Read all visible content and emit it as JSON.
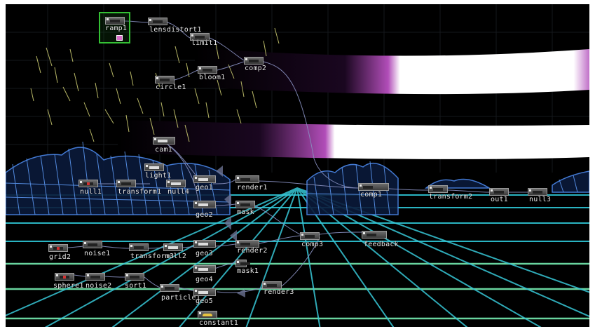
{
  "app": {
    "colors": {
      "canvas_background": "#000000",
      "grid_cyan": "#3fd7e0",
      "grid_green": "#7fe8a0",
      "terrain_blue": "#4a86e8",
      "band_magenta": "#c04fc0",
      "band_white": "#ffffff",
      "spark_yellow": "#d8d878",
      "node_selection_green": "#34c034",
      "wire_color": "#8890c0"
    }
  },
  "network": {
    "nodes": [
      {
        "id": "ramp1",
        "label": "ramp1",
        "icon": "ramp-op-icon",
        "selected": true
      },
      {
        "id": "lensdistort1",
        "label": "lensdistort1",
        "icon": "lensdistort-op-icon"
      },
      {
        "id": "limit1",
        "label": "limit1",
        "icon": "limit-op-icon"
      },
      {
        "id": "comp2",
        "label": "comp2",
        "icon": "comp-op-icon"
      },
      {
        "id": "bloom1",
        "label": "bloom1",
        "icon": "bloom-op-icon"
      },
      {
        "id": "circle1",
        "label": "circle1",
        "icon": "circle-op-icon"
      },
      {
        "id": "cam1",
        "label": "cam1",
        "icon": "camera-op-icon"
      },
      {
        "id": "light1",
        "label": "light1",
        "icon": "light-op-icon"
      },
      {
        "id": "null1",
        "label": "null1",
        "icon": "null-op-icon"
      },
      {
        "id": "transform1",
        "label": "transform1",
        "icon": "transform-op-icon"
      },
      {
        "id": "null4",
        "label": "null4",
        "icon": "null-op-icon"
      },
      {
        "id": "geo1",
        "label": "geo1",
        "icon": "geo-op-icon"
      },
      {
        "id": "render1",
        "label": "render1",
        "icon": "render-op-icon"
      },
      {
        "id": "geo2",
        "label": "geo2",
        "icon": "geo-op-icon"
      },
      {
        "id": "mask",
        "label": "mask",
        "icon": "mask-op-icon"
      },
      {
        "id": "comp1",
        "label": "comp1",
        "icon": "comp-op-icon"
      },
      {
        "id": "transform2",
        "label": "transform2",
        "icon": "transform-op-icon"
      },
      {
        "id": "out1",
        "label": "out1",
        "icon": "out-op-icon"
      },
      {
        "id": "null3",
        "label": "null3",
        "icon": "null-op-icon"
      },
      {
        "id": "grid2",
        "label": "grid2",
        "icon": "grid-op-icon"
      },
      {
        "id": "noise1",
        "label": "noise1",
        "icon": "noise-op-icon"
      },
      {
        "id": "transform3",
        "label": "transform3",
        "icon": "transform-op-icon"
      },
      {
        "id": "null2",
        "label": "null2",
        "icon": "null-op-icon"
      },
      {
        "id": "geo3",
        "label": "geo3",
        "icon": "geo-op-icon"
      },
      {
        "id": "render2",
        "label": "render2",
        "icon": "render-op-icon"
      },
      {
        "id": "comp3",
        "label": "comp3",
        "icon": "comp-op-icon"
      },
      {
        "id": "feedback",
        "label": "feedback",
        "icon": "feedback-op-icon"
      },
      {
        "id": "mask1",
        "label": "mask1",
        "icon": "mask-op-icon"
      },
      {
        "id": "sphere1",
        "label": "sphere1",
        "icon": "sphere-op-icon"
      },
      {
        "id": "noise2",
        "label": "noise2",
        "icon": "noise-op-icon"
      },
      {
        "id": "sort1",
        "label": "sort1",
        "icon": "sort-op-icon"
      },
      {
        "id": "geo4",
        "label": "geo4",
        "icon": "geo-op-icon"
      },
      {
        "id": "particle1",
        "label": "particle1",
        "icon": "particle-op-icon"
      },
      {
        "id": "geo5",
        "label": "geo5",
        "icon": "geo-op-icon"
      },
      {
        "id": "render3",
        "label": "render3",
        "icon": "render-op-icon"
      },
      {
        "id": "constant1",
        "label": "constant1",
        "icon": "constant-op-icon"
      }
    ]
  }
}
